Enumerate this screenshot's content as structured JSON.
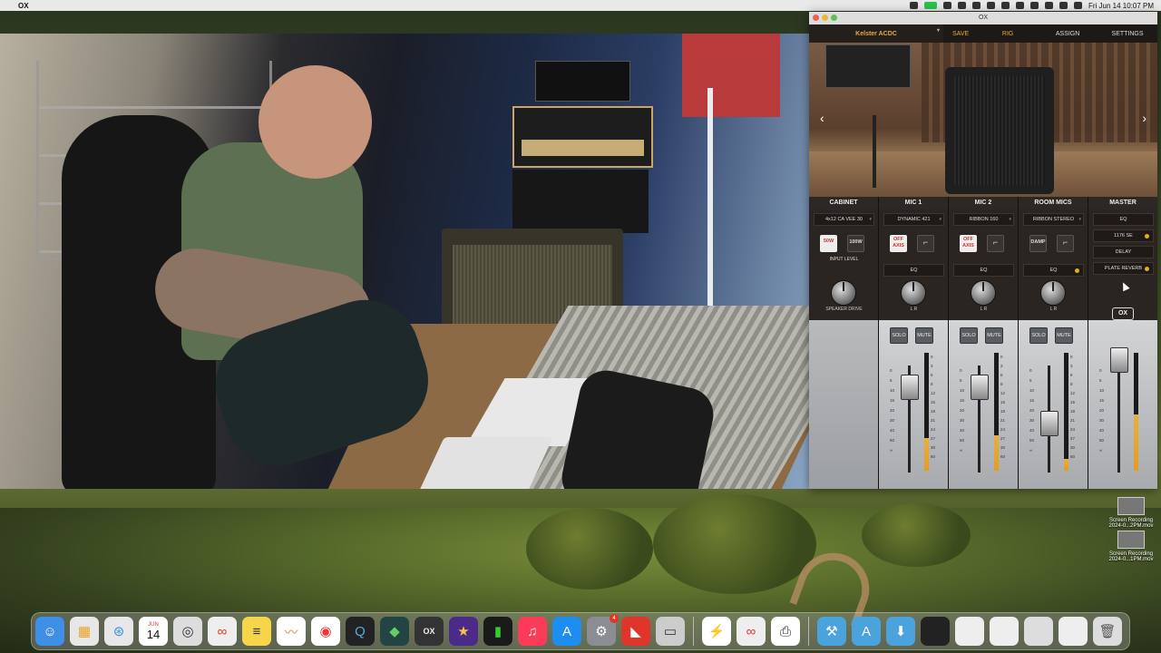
{
  "menubar": {
    "app_name": "OX",
    "clock": "Fri Jun 14  10:07 PM"
  },
  "ox": {
    "window_title": "OX",
    "rig_name": "Kelster ACDC",
    "nav": [
      "SAVE",
      "RIG",
      "ASSIGN",
      "SETTINGS"
    ],
    "channels": [
      {
        "title": "CABINET",
        "select": "4x12 CA VEE 30"
      },
      {
        "title": "MIC 1",
        "select": "DYNAMIC 421"
      },
      {
        "title": "MIC 2",
        "select": "RIBBON 160"
      },
      {
        "title": "ROOM MICS",
        "select": "RIBBON STEREO"
      },
      {
        "title": "MASTER"
      }
    ],
    "cabinet": {
      "btn_50w": "50W",
      "btn_100w": "100W",
      "input_level": "INPUT LEVEL",
      "knob_label": "SPEAKER DRIVE"
    },
    "off_axis": "OFF AXIS",
    "damp": "DAMP",
    "eq": "EQ",
    "solo": "SOLO",
    "mute": "MUTE",
    "knob_lr": "L          R",
    "master_items": [
      "EQ",
      "1176 SE",
      "DELAY",
      "PLATE REVERB"
    ],
    "logo": "OX",
    "fader_scale": [
      "0",
      "5",
      "10",
      "15",
      "20",
      "30",
      "40",
      "50",
      "∞"
    ],
    "meter_scale": [
      "0",
      "3",
      "6",
      "9",
      "12",
      "15",
      "18",
      "21",
      "24",
      "27",
      "30",
      "60"
    ]
  },
  "desktop_files": [
    {
      "name": "Screen Recording 2024-0...2PM.mov"
    },
    {
      "name": "Screen Recording 2024-0...1PM.mov"
    }
  ],
  "dock": {
    "calendar_month": "JUN",
    "calendar_day": "14",
    "badge": "4"
  }
}
